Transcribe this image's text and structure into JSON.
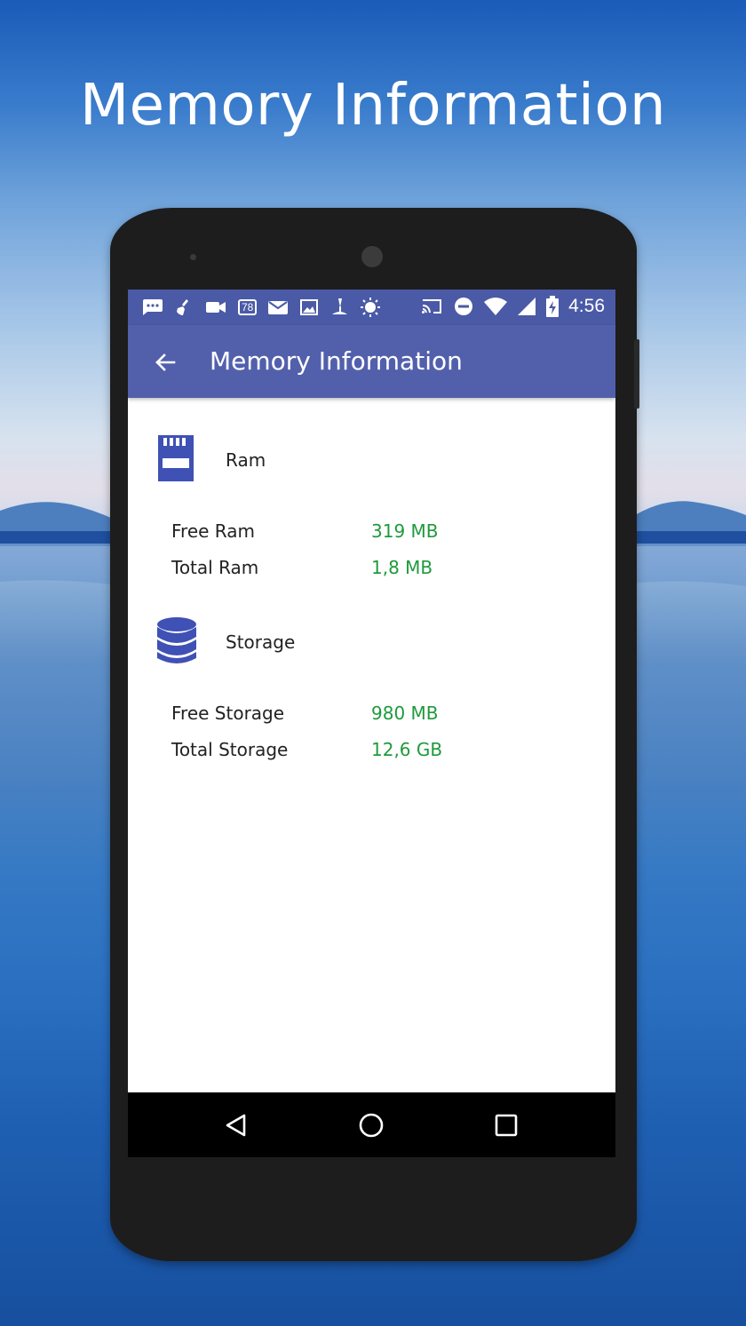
{
  "headline": "Memory Information",
  "statusbar": {
    "time": "4:56",
    "badge_text": "78",
    "left_icons": [
      "message-icon",
      "broom-icon",
      "video-icon",
      "badge-78-icon",
      "mail-icon",
      "image-icon",
      "tool-icon",
      "sun-icon"
    ],
    "right_icons": [
      "cast-icon",
      "do-not-disturb-icon",
      "wifi-icon",
      "cell-signal-icon",
      "battery-charging-icon"
    ]
  },
  "toolbar": {
    "title": "Memory Information",
    "back_icon": "arrow-left-icon"
  },
  "sections": {
    "ram": {
      "label": "Ram",
      "icon": "sd-card-icon",
      "rows": [
        {
          "label": "Free Ram",
          "value": "319 MB"
        },
        {
          "label": "Total Ram",
          "value": "1,8 MB"
        }
      ]
    },
    "storage": {
      "label": "Storage",
      "icon": "database-icon",
      "rows": [
        {
          "label": "Free Storage",
          "value": "980 MB"
        },
        {
          "label": "Total Storage",
          "value": "12,6 GB"
        }
      ]
    }
  },
  "navbar": {
    "icons": [
      "back-triangle-icon",
      "home-circle-icon",
      "recents-square-icon"
    ]
  },
  "colors": {
    "toolbar": "#5260ac",
    "statusbar": "#4a5aa6",
    "value_green": "#1f9a3c",
    "icon_blue": "#3f51b5"
  }
}
